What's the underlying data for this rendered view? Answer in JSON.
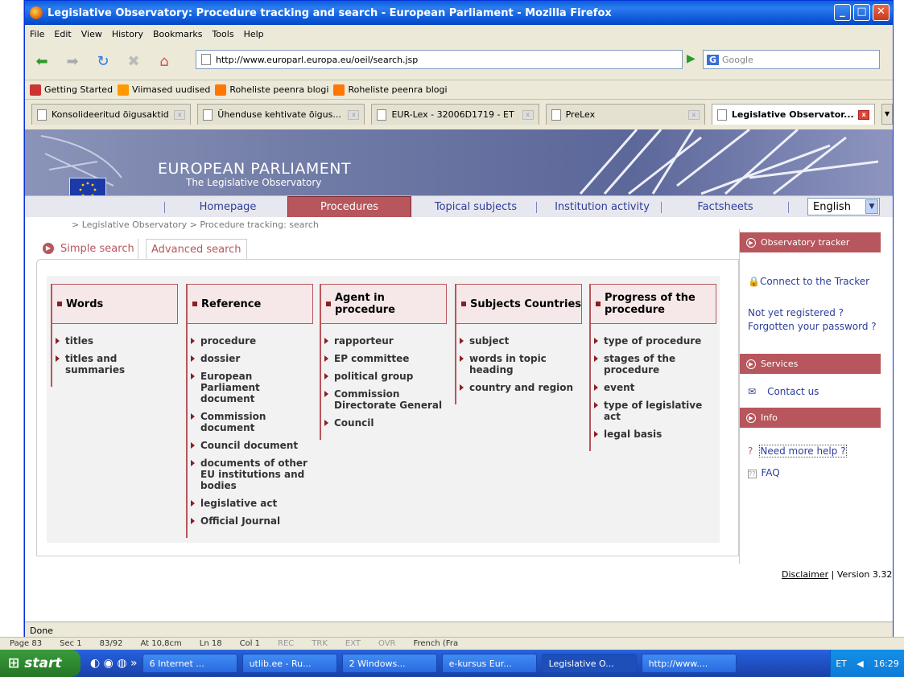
{
  "window": {
    "title": "Legislative Observatory: Procedure tracking and search - European Parliament - Mozilla Firefox"
  },
  "menu": [
    "File",
    "Edit",
    "View",
    "History",
    "Bookmarks",
    "Tools",
    "Help"
  ],
  "url": "http://www.europarl.europa.eu/oeil/search.jsp",
  "search_placeholder": "Google",
  "bookmarks": [
    "Getting Started",
    "Viimased uudised",
    "Roheliste peenra blogi",
    "Roheliste peenra blogi"
  ],
  "tabs": [
    "Konsolideeritud õigusaktid",
    "Ühenduse kehtivate õigus...",
    "EUR-Lex - 32006D1719 - ET",
    "PreLex",
    "Legislative Observator..."
  ],
  "site": {
    "title": "EUROPEAN PARLIAMENT",
    "subtitle": "The Legislative Observatory",
    "nav": [
      "Homepage",
      "Procedures",
      "Topical subjects",
      "Institution activity",
      "Factsheets"
    ],
    "language": "English",
    "breadcrumb": "> Legislative Observatory > Procedure tracking: search"
  },
  "search_tabs": {
    "simple": "Simple search",
    "advanced": "Advanced search"
  },
  "columns": [
    {
      "title": "Words",
      "links": [
        "titles",
        "titles and summaries"
      ]
    },
    {
      "title": "Reference",
      "links": [
        "procedure",
        "dossier",
        "European Parliament document",
        "Commission document",
        "Council document",
        "documents of other EU institutions and bodies",
        "legislative act",
        "Official Journal"
      ]
    },
    {
      "title": "Agent in procedure",
      "links": [
        "rapporteur",
        "EP committee",
        "political group",
        "Commission Directorate General",
        "Council"
      ]
    },
    {
      "title": "Subjects Countries",
      "links": [
        "subject",
        "words in topic heading",
        "country and region"
      ]
    },
    {
      "title": "Progress of the procedure",
      "links": [
        "type of procedure",
        "stages of the procedure",
        "event",
        "type of legislative act",
        "legal basis"
      ]
    }
  ],
  "sidebar": {
    "tracker_header": "Observatory tracker",
    "connect": "Connect to the Tracker",
    "not_registered": "Not yet registered ?",
    "forgotten": "Forgotten your password ?",
    "services_header": "Services",
    "contact": "Contact us",
    "info_header": "Info",
    "help": "Need more help ?",
    "faq": "FAQ"
  },
  "footer": {
    "disclaimer": "Disclaimer",
    "version": "| Version 3.32"
  },
  "status": "Done",
  "word_status": [
    "Page 83",
    "Sec 1",
    "83/92",
    "At 10,8cm",
    "Ln 18",
    "Col 1",
    "REC",
    "TRK",
    "EXT",
    "OVR",
    "French (Fra"
  ],
  "taskbar": {
    "start": "start",
    "items": [
      "6 Internet ...",
      "utlib.ee - Ru...",
      "2 Windows...",
      "e-kursus Eur...",
      "Legislative O...",
      "http://www...."
    ],
    "lang": "ET",
    "time": "16:29"
  }
}
